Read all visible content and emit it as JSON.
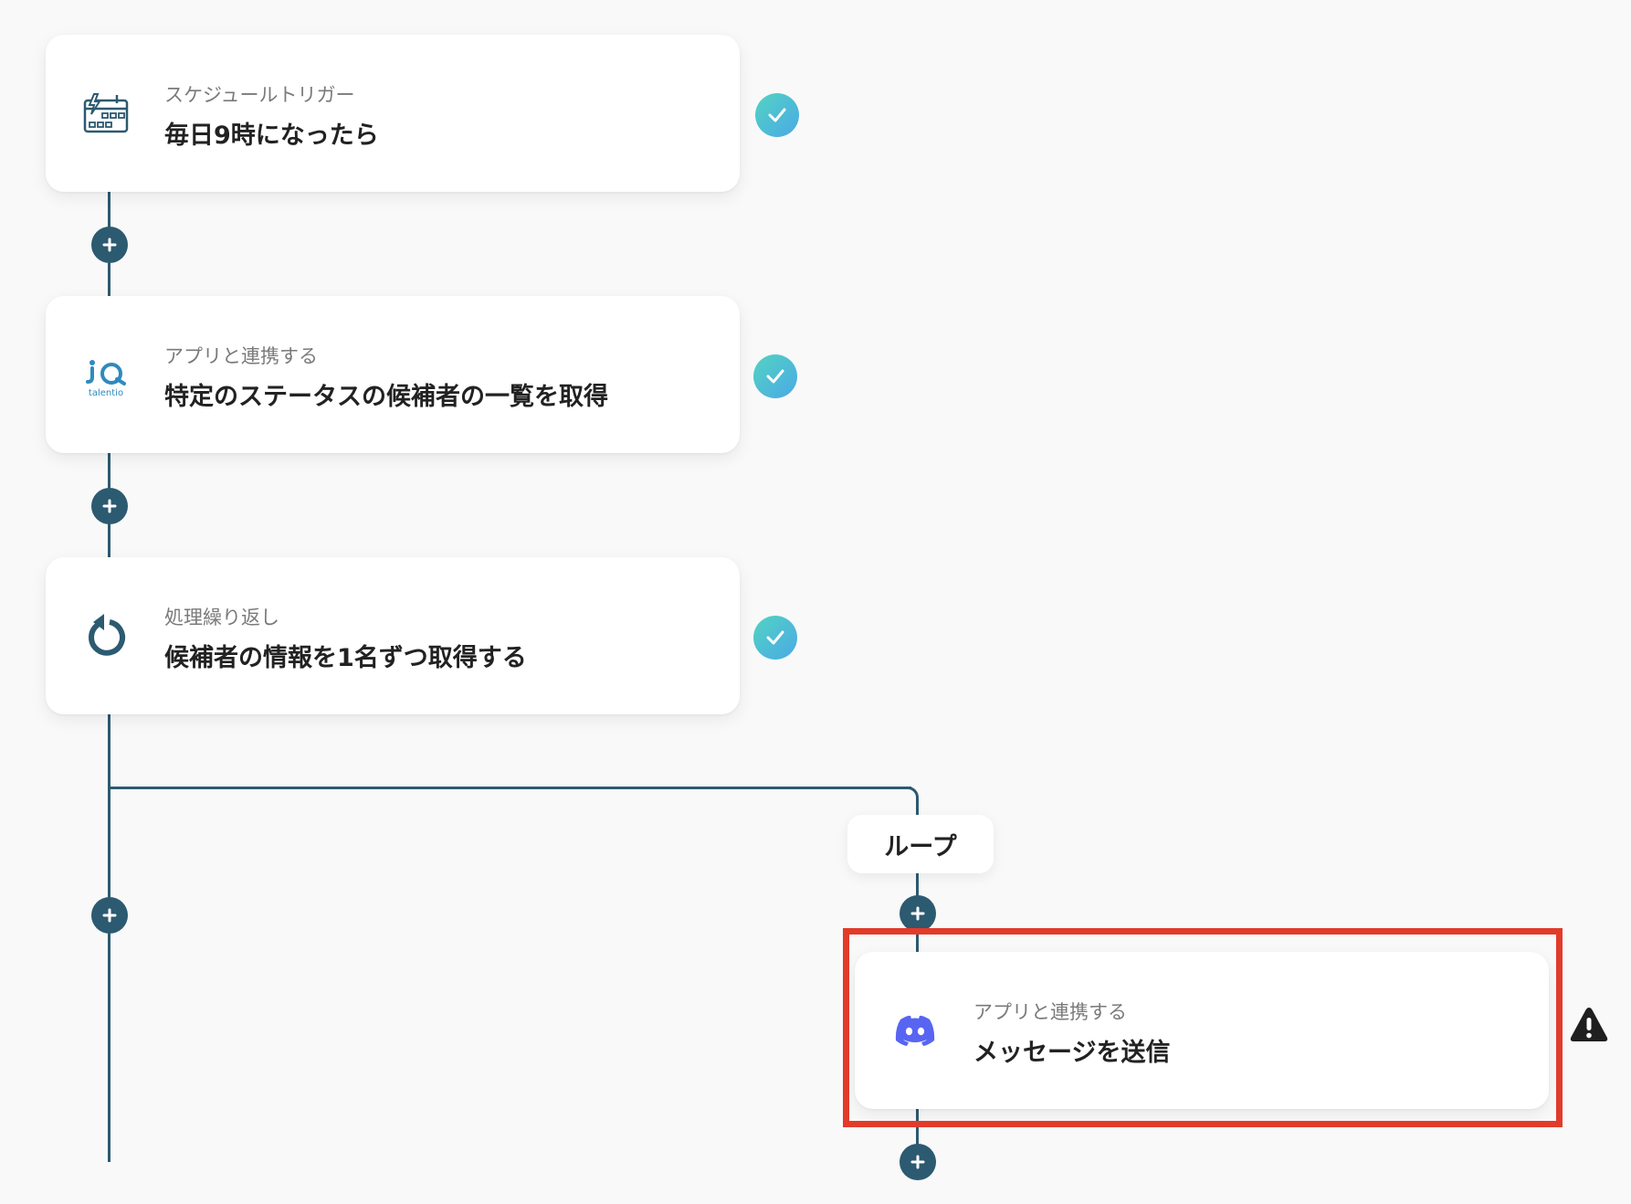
{
  "steps": [
    {
      "subtitle": "スケジュールトリガー",
      "title": "毎日9時になったら",
      "icon": "schedule-trigger-icon",
      "status": "completed"
    },
    {
      "subtitle": "アプリと連携する",
      "title": "特定のステータスの候補者の一覧を取得",
      "icon": "talentio-logo",
      "status": "completed"
    },
    {
      "subtitle": "処理繰り返し",
      "title": "候補者の情報を1名ずつ取得する",
      "icon": "loop-arrow-icon",
      "status": "completed"
    }
  ],
  "loop": {
    "label": "ループ",
    "steps": [
      {
        "subtitle": "アプリと連携する",
        "title": "メッセージを送信",
        "icon": "discord-logo",
        "status": "warning"
      }
    ]
  },
  "colors": {
    "connector": "#2c5a70",
    "check_gradient": [
      "#53d3c2",
      "#4aa9e6"
    ],
    "highlight": "#e23b2a",
    "discord": "#5865f2"
  }
}
